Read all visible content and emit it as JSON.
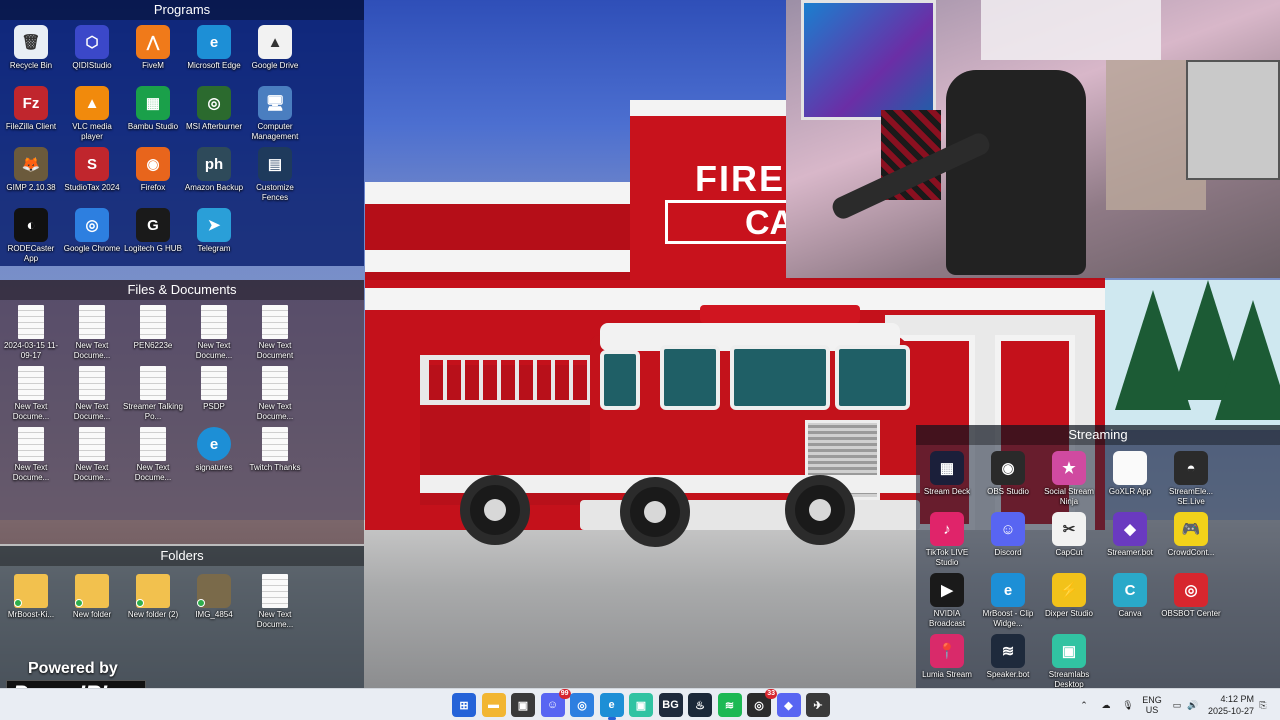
{
  "wallpaper": {
    "sign_line1": "FIRE",
    "sign_line2": "CA"
  },
  "fences": {
    "programs": {
      "title": "Programs",
      "items": [
        {
          "label": "Recycle Bin",
          "icon": "recycle-bin-icon",
          "color": "#e8eef5",
          "glyph": "🗑"
        },
        {
          "label": "QIDIStudio",
          "icon": "qidistudio-icon",
          "color": "#3b48c9",
          "glyph": "⬡"
        },
        {
          "label": "FiveM",
          "icon": "fivem-icon",
          "color": "#f07a1a",
          "glyph": "⋀"
        },
        {
          "label": "Microsoft Edge",
          "icon": "edge-icon",
          "color": "#1d8fd6",
          "glyph": "e"
        },
        {
          "label": "Google Drive",
          "icon": "google-drive-icon",
          "color": "#f2f2f2",
          "glyph": "▲"
        },
        {
          "label": "FileZilla Client",
          "icon": "filezilla-icon",
          "color": "#c0262d",
          "glyph": "Fz"
        },
        {
          "label": "VLC media player",
          "icon": "vlc-icon",
          "color": "#f18a0c",
          "glyph": "▲"
        },
        {
          "label": "Bambu Studio",
          "icon": "bambu-icon",
          "color": "#1aa04a",
          "glyph": "▦"
        },
        {
          "label": "MSI Afterburner",
          "icon": "msi-afterburner-icon",
          "color": "#2b6a2e",
          "glyph": "◎"
        },
        {
          "label": "Computer Management",
          "icon": "computer-management-icon",
          "color": "#4a7ec0",
          "glyph": "🖥"
        },
        {
          "label": "GIMP 2.10.38",
          "icon": "gimp-icon",
          "color": "#6b5a3c",
          "glyph": "🦊"
        },
        {
          "label": "StudioTax 2024",
          "icon": "studiotax-icon",
          "color": "#c0262d",
          "glyph": "S"
        },
        {
          "label": "Firefox",
          "icon": "firefox-icon",
          "color": "#e8651c",
          "glyph": "◉"
        },
        {
          "label": "Amazon Backup",
          "icon": "amazon-photos-icon",
          "color": "#2e4a5a",
          "glyph": "ph"
        },
        {
          "label": "Customize Fences",
          "icon": "fences-icon",
          "color": "#1e3a5c",
          "glyph": "▤"
        },
        {
          "label": "RODECaster App",
          "icon": "rodecaster-icon",
          "color": "#111111",
          "glyph": "◐"
        },
        {
          "label": "Google Chrome",
          "icon": "chrome-icon",
          "color": "#2d7fe0",
          "glyph": "◎"
        },
        {
          "label": "Logitech G HUB",
          "icon": "logitech-icon",
          "color": "#1a1a1a",
          "glyph": "G"
        },
        {
          "label": "Telegram",
          "icon": "telegram-icon",
          "color": "#2a9fd8",
          "glyph": "➤"
        }
      ]
    },
    "files": {
      "title": "Files & Documents",
      "items": [
        {
          "label": "2024-03-15 11-09-17",
          "type": "doc"
        },
        {
          "label": "New Text Docume...",
          "type": "doc"
        },
        {
          "label": "PEN6223e",
          "type": "doc"
        },
        {
          "label": "New Text Docume...",
          "type": "doc"
        },
        {
          "label": "New Text Document",
          "type": "doc"
        },
        {
          "label": "New Text Docume...",
          "type": "doc"
        },
        {
          "label": "New Text Docume...",
          "type": "doc"
        },
        {
          "label": "Streamer Talking Po...",
          "type": "doc"
        },
        {
          "label": "PSDP",
          "type": "doc"
        },
        {
          "label": "New Text Docume...",
          "type": "doc"
        },
        {
          "label": "New Text Docume...",
          "type": "doc"
        },
        {
          "label": "New Text Docume...",
          "type": "doc"
        },
        {
          "label": "New Text Docume...",
          "type": "doc"
        },
        {
          "label": "signatures",
          "type": "edge"
        },
        {
          "label": "Twitch Thanks",
          "type": "doc"
        }
      ]
    },
    "folders": {
      "title": "Folders",
      "items": [
        {
          "label": "MrBoost-Ki...",
          "type": "folder"
        },
        {
          "label": "New folder",
          "type": "folder"
        },
        {
          "label": "New folder (2)",
          "type": "folder"
        },
        {
          "label": "IMG_4854",
          "type": "image"
        },
        {
          "label": "New Text Docume...",
          "type": "doc"
        }
      ]
    },
    "streaming": {
      "title": "Streaming",
      "items": [
        {
          "label": "Stream Deck",
          "icon": "stream-deck-icon",
          "color": "#1b1f3a",
          "glyph": "▦"
        },
        {
          "label": "OBS Studio",
          "icon": "obs-icon",
          "color": "#2a2a2a",
          "glyph": "◉"
        },
        {
          "label": "Social Stream Ninja",
          "icon": "social-stream-ninja-icon",
          "color": "#d04aa0",
          "glyph": "★"
        },
        {
          "label": "GoXLR App",
          "icon": "goxlr-icon",
          "color": "#fafafa",
          "glyph": ""
        },
        {
          "label": "StreamEle... SE.Live",
          "icon": "streamelements-icon",
          "color": "#2b2b2b",
          "glyph": "◓"
        },
        {
          "label": "TikTok LIVE Studio",
          "icon": "tiktok-icon",
          "color": "#e0246a",
          "glyph": "♪"
        },
        {
          "label": "Discord",
          "icon": "discord-icon",
          "color": "#5865f2",
          "glyph": "☺"
        },
        {
          "label": "CapCut",
          "icon": "capcut-icon",
          "color": "#f2f2f2",
          "glyph": "✂"
        },
        {
          "label": "Streamer.bot",
          "icon": "streamerbot-icon",
          "color": "#6a3ac0",
          "glyph": "◆"
        },
        {
          "label": "CrowdCont...",
          "icon": "crowdcontrol-icon",
          "color": "#f2d21a",
          "glyph": "🎮"
        },
        {
          "label": "NVIDIA Broadcast",
          "icon": "nvidia-broadcast-icon",
          "color": "#1a1a1a",
          "glyph": "▶"
        },
        {
          "label": "MrBoost - Clip Widge...",
          "icon": "mrboost-edge-icon",
          "color": "#1d8fd6",
          "glyph": "e"
        },
        {
          "label": "Dixper Studio",
          "icon": "dixper-icon",
          "color": "#f2c21a",
          "glyph": "⚡"
        },
        {
          "label": "Canva",
          "icon": "canva-icon",
          "color": "#2aa9c9",
          "glyph": "C"
        },
        {
          "label": "OBSBOT Center",
          "icon": "obsbot-icon",
          "color": "#d7262e",
          "glyph": "◎"
        },
        {
          "label": "Lumia Stream",
          "icon": "lumia-icon",
          "color": "#d92a6a",
          "glyph": "📍"
        },
        {
          "label": "Speaker.bot",
          "icon": "speakerbot-icon",
          "color": "#1e2a3c",
          "glyph": "≋"
        },
        {
          "label": "Streamlabs Desktop",
          "icon": "streamlabs-icon",
          "color": "#31c3a2",
          "glyph": "▣"
        }
      ]
    }
  },
  "brand": {
    "line1": "Powered by",
    "line2": "PowerIRL"
  },
  "taskbar": {
    "apps": [
      {
        "name": "start-button",
        "color": "#2563d8",
        "glyph": "⊞"
      },
      {
        "name": "file-explorer-icon",
        "color": "#f2b632",
        "glyph": "▬"
      },
      {
        "name": "store-icon",
        "color": "#3a3a3a",
        "glyph": "▣"
      },
      {
        "name": "discord-taskbar-icon",
        "color": "#5865f2",
        "glyph": "☺",
        "badge": "99"
      },
      {
        "name": "chrome-taskbar-icon",
        "color": "#2d7fe0",
        "glyph": "◎"
      },
      {
        "name": "edge-taskbar-icon",
        "color": "#1d8fd6",
        "glyph": "e",
        "active": true
      },
      {
        "name": "streamlabs-taskbar-icon",
        "color": "#31c3a2",
        "glyph": "▣"
      },
      {
        "name": "bg-taskbar-icon",
        "color": "#1e2a3c",
        "glyph": "BG"
      },
      {
        "name": "steam-taskbar-icon",
        "color": "#1b2838",
        "glyph": "♨"
      },
      {
        "name": "spotify-taskbar-icon",
        "color": "#1db954",
        "glyph": "≋"
      },
      {
        "name": "red-badge-app-icon",
        "color": "#2b2b2b",
        "glyph": "◎",
        "badge": "33"
      },
      {
        "name": "streamerbot-taskbar-icon",
        "color": "#5865f2",
        "glyph": "◆"
      },
      {
        "name": "game-taskbar-icon",
        "color": "#3a3a3a",
        "glyph": "✈"
      }
    ],
    "language": "ENG",
    "region": "US",
    "time": "4:12 PM",
    "date": "2025-10-27"
  }
}
